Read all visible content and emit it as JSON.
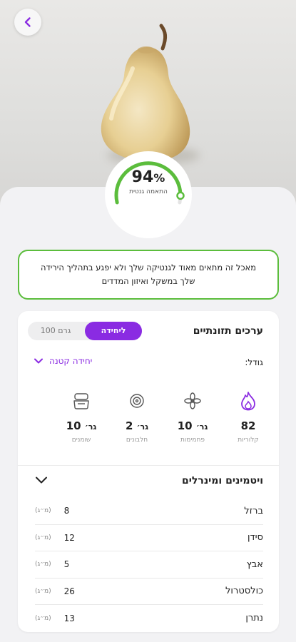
{
  "food": {
    "name": "אגס",
    "match_percent": "94",
    "match_symbol": "%",
    "match_fraction": 0.94,
    "match_label": "התאמה גנטית"
  },
  "note": {
    "text": "מאכל זה מתאים מאוד לגנטיקה שלך ולא יפגע בתהליך הירידה שלך במשקל ואיזון המדדים"
  },
  "nutrition": {
    "title": "ערכים תזונתיים",
    "toggle_unit": "ליחידה",
    "toggle_gram": "100 גרם",
    "size_label": "גודל:",
    "size_value": "יחידה קטנה",
    "items": [
      {
        "icon": "flame-icon",
        "value": "82",
        "unit": "",
        "label": "קלוריות"
      },
      {
        "icon": "fiber-icon",
        "value": "10",
        "unit": "גר׳",
        "label": "פחמימות"
      },
      {
        "icon": "protein-icon",
        "value": "2",
        "unit": "גר׳",
        "label": "חלבונים"
      },
      {
        "icon": "fat-icon",
        "value": "10",
        "unit": "גר׳",
        "label": "שומנים"
      }
    ]
  },
  "vitamins": {
    "title": "ויטמינים ומינרלים",
    "rows": [
      {
        "name": "ברזל",
        "value": "8",
        "unit": "(מ״ג)"
      },
      {
        "name": "סידן",
        "value": "12",
        "unit": "(מ״ג)"
      },
      {
        "name": "אבץ",
        "value": "5",
        "unit": "(מ״ג)"
      },
      {
        "name": "כולסטרול",
        "value": "26",
        "unit": "(מ״ג)"
      },
      {
        "name": "נתרן",
        "value": "13",
        "unit": "(מ״ג)"
      }
    ]
  },
  "colors": {
    "accent": "#8a2be2",
    "match_green": "#5bbd3c"
  }
}
